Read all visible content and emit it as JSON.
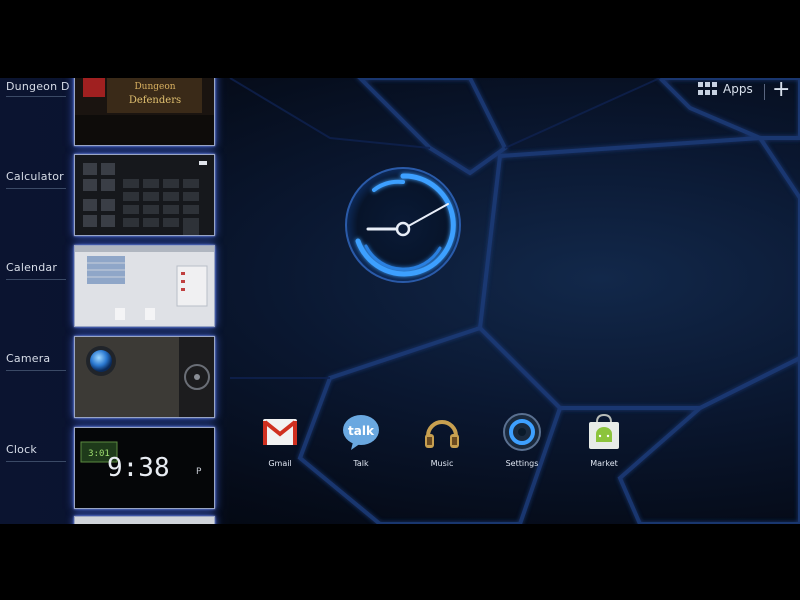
{
  "recents": [
    {
      "label": "Dungeon D",
      "thumb": "dungeon"
    },
    {
      "label": "Calculator",
      "thumb": "calculator"
    },
    {
      "label": "Calendar",
      "thumb": "calendar"
    },
    {
      "label": "Camera",
      "thumb": "camera"
    },
    {
      "label": "Clock",
      "thumb": "clock"
    }
  ],
  "dungeon_thumb_text": [
    "Dungeon",
    "Defenders"
  ],
  "clock_thumb": {
    "badge": "3:01",
    "time": "9:38",
    "suffix": "P"
  },
  "topbar": {
    "apps_label": "Apps",
    "add_label": "+"
  },
  "dock": [
    {
      "label": "Gmail",
      "icon": "gmail-icon"
    },
    {
      "label": "Talk",
      "icon": "talk-icon"
    },
    {
      "label": "Music",
      "icon": "music-icon"
    },
    {
      "label": "Settings",
      "icon": "settings-icon"
    },
    {
      "label": "Market",
      "icon": "market-icon"
    }
  ],
  "talk_icon_text": "talk",
  "colors": {
    "accent": "#3ea0ff",
    "panel": "#0a1330",
    "glow": "#4466dd"
  }
}
